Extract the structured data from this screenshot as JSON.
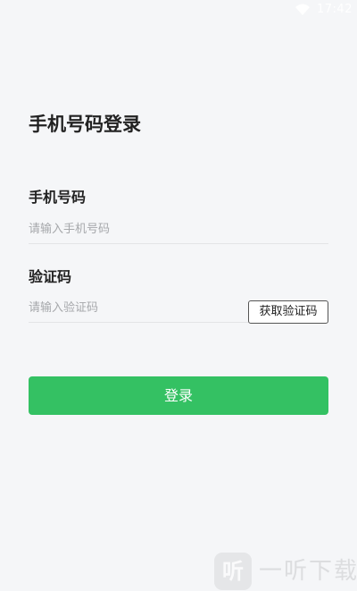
{
  "status_bar": {
    "time": "17:42",
    "icons": [
      "wifi-icon"
    ]
  },
  "login": {
    "title": "手机号码登录",
    "phone_label": "手机号码",
    "phone_placeholder": "请输入手机号码",
    "code_label": "验证码",
    "code_placeholder": "请输入验证码",
    "get_code_label": "获取验证码",
    "login_label": "登录"
  },
  "watermark": {
    "badge_text": "听",
    "text": "一听下载"
  },
  "colors": {
    "background": "#f5f6f8",
    "primary": "#34c163",
    "text": "#222222",
    "placeholder": "#a6a8ab",
    "divider": "#e3e4e6"
  }
}
